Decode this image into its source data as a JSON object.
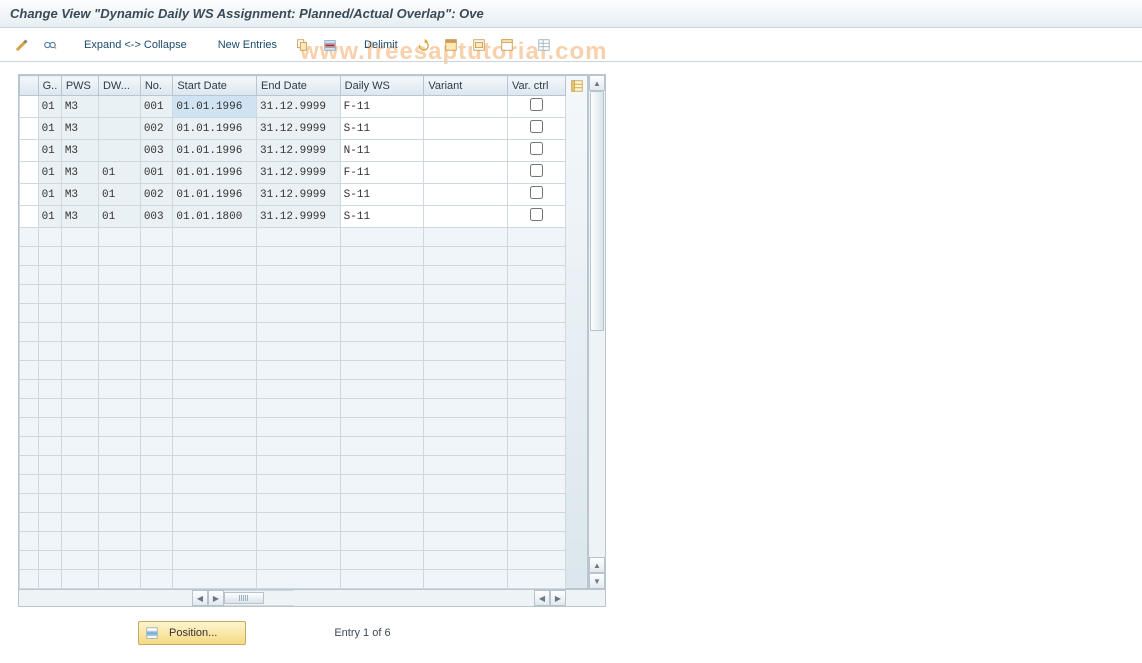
{
  "title": "Change View \"Dynamic Daily WS Assignment: Planned/Actual Overlap\": Ove",
  "watermark": "www.freesaptutorial.com",
  "toolbar": {
    "expand_collapse": "Expand <-> Collapse",
    "new_entries": "New Entries",
    "delimit": "Delimit"
  },
  "columns": {
    "g": "G..",
    "pws": "PWS",
    "dw": "DW...",
    "no": "No.",
    "start": "Start Date",
    "end": "End Date",
    "dailyws": "Daily WS",
    "variant": "Variant",
    "varctrl": "Var. ctrl"
  },
  "rows": [
    {
      "g": "01",
      "pws": "M3",
      "dw": "",
      "no": "001",
      "start": "01.01.1996",
      "end": "31.12.9999",
      "dailyws": "F-11",
      "variant": "",
      "varctrl": false,
      "startSelected": true
    },
    {
      "g": "01",
      "pws": "M3",
      "dw": "",
      "no": "002",
      "start": "01.01.1996",
      "end": "31.12.9999",
      "dailyws": "S-11",
      "variant": "",
      "varctrl": false
    },
    {
      "g": "01",
      "pws": "M3",
      "dw": "",
      "no": "003",
      "start": "01.01.1996",
      "end": "31.12.9999",
      "dailyws": "N-11",
      "variant": "",
      "varctrl": false
    },
    {
      "g": "01",
      "pws": "M3",
      "dw": "01",
      "no": "001",
      "start": "01.01.1996",
      "end": "31.12.9999",
      "dailyws": "F-11",
      "variant": "",
      "varctrl": false
    },
    {
      "g": "01",
      "pws": "M3",
      "dw": "01",
      "no": "002",
      "start": "01.01.1996",
      "end": "31.12.9999",
      "dailyws": "S-11",
      "variant": "",
      "varctrl": false
    },
    {
      "g": "01",
      "pws": "M3",
      "dw": "01",
      "no": "003",
      "start": "01.01.1800",
      "end": "31.12.9999",
      "dailyws": "S-11",
      "variant": "",
      "varctrl": false
    }
  ],
  "empty_rows": 19,
  "footer": {
    "position": "Position...",
    "entry": "Entry 1 of 6"
  }
}
